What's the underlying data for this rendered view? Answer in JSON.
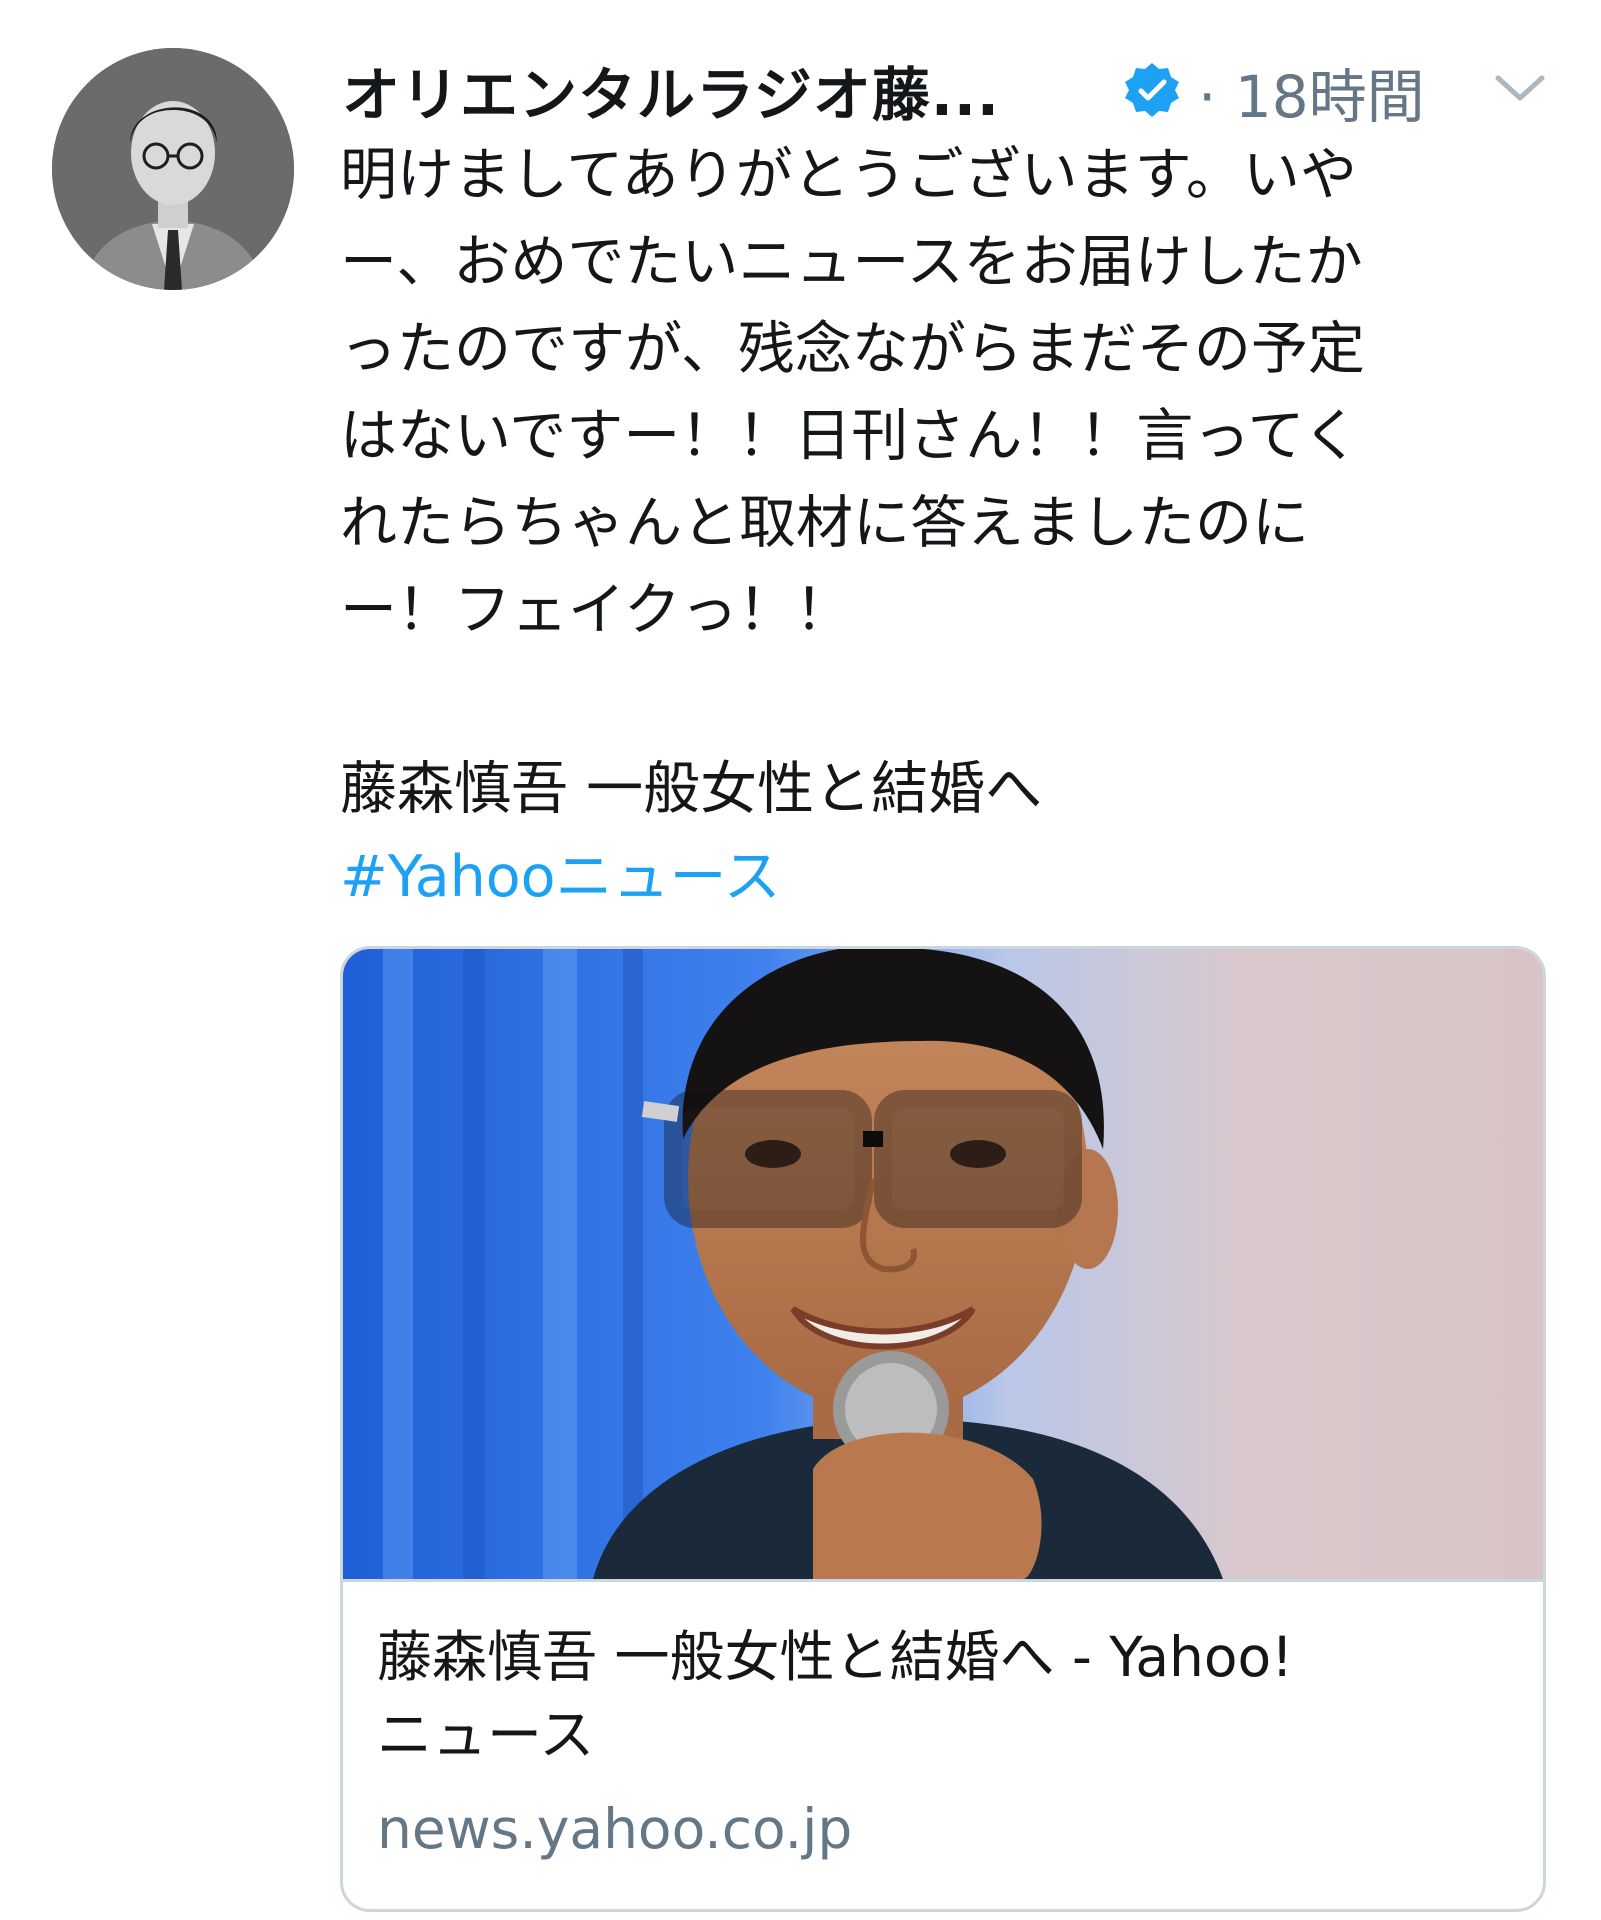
{
  "tweet": {
    "display_name": "オリエンタルラジオ藤...",
    "timestamp": "· 18時間",
    "verified_icon": "verified-badge-icon",
    "menu_icon": "chevron-down-icon",
    "body_lines": [
      "明けましてありがとうございます。いや",
      "ー、おめでたいニュースをお届けしたか",
      "ったのですが、残念ながらまだその予定",
      "はないですー！！日刊さん！！言ってく",
      "れたらちゃんと取材に答えましたのに",
      "ー！フェイクっ！！"
    ],
    "news_title": "藤森慎吾 一般女性と結婚へ",
    "hashtag": "#Yahooニュース"
  },
  "card": {
    "title_lines": [
      "藤森慎吾 一般女性と結婚へ - Yahoo!",
      "ニュース"
    ],
    "domain": "news.yahoo.co.jp"
  },
  "colors": {
    "link": "#1da1f2",
    "secondary_text": "#657786",
    "border": "#ccd6dd",
    "verified": "#1da1f2"
  }
}
